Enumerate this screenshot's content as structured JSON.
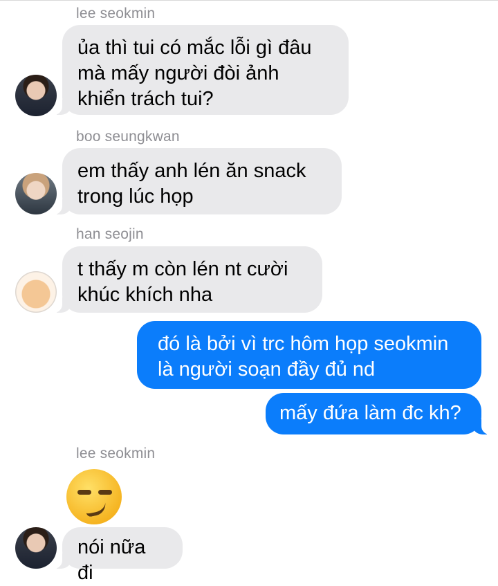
{
  "thread": {
    "messages": [
      {
        "sender": "lee seokmin",
        "text": "ủa thì tui có mắc lỗi gì đâu\nmà mấy người đòi ảnh\nkhiển trách tui?"
      },
      {
        "sender": "boo seungkwan",
        "text": "em thấy anh lén ăn snack\ntrong lúc họp"
      },
      {
        "sender": "han seojin",
        "text": "t thấy m còn lén nt cười\nkhúc khích nha"
      },
      {
        "sender": "",
        "text": "đó là bởi vì trc hôm họp seokmin\nlà người soạn đầy đủ nd"
      },
      {
        "sender": "",
        "text": "mấy đứa làm đc kh?"
      },
      {
        "sender": "lee seokmin",
        "text": "😏"
      },
      {
        "sender": "lee seokmin",
        "text": "nói nữa đi"
      }
    ]
  },
  "colors": {
    "incoming_bubble": "#e9e9eb",
    "outgoing_bubble": "#0b7dfb",
    "sender_label": "#8e8e93"
  },
  "icons": {
    "emoji": "smirking-face-emoji",
    "avatars": [
      "avatar-lee-seokmin",
      "avatar-boo-seungkwan",
      "avatar-han-seojin"
    ]
  }
}
